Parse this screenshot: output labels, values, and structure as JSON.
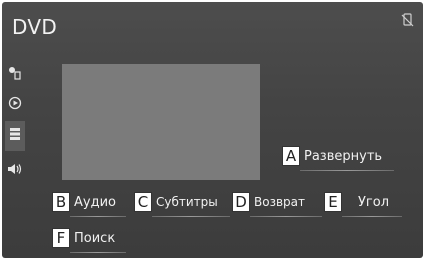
{
  "screen": {
    "title": "DVD",
    "status_icon": "phone-disconnected-icon"
  },
  "sidebar": {
    "items": [
      {
        "icon": "source-settings-icon",
        "active": false
      },
      {
        "icon": "play-icon",
        "active": false
      },
      {
        "icon": "menu-list-icon",
        "active": true
      },
      {
        "icon": "speaker-volume-icon",
        "active": false
      }
    ]
  },
  "controls": {
    "expand": {
      "marker": "A",
      "label": "Развернуть"
    },
    "audio": {
      "marker": "B",
      "label": "Аудио"
    },
    "subtitles": {
      "marker": "C",
      "label": "Субтитры"
    },
    "return": {
      "marker": "D",
      "label": "Возврат"
    },
    "angle": {
      "marker": "E",
      "label": "Угол"
    },
    "search": {
      "marker": "F",
      "label": "Поиск"
    }
  },
  "colors": {
    "background": "#444444",
    "video_area": "#7b7b7b",
    "text": "#f2f2f2"
  }
}
